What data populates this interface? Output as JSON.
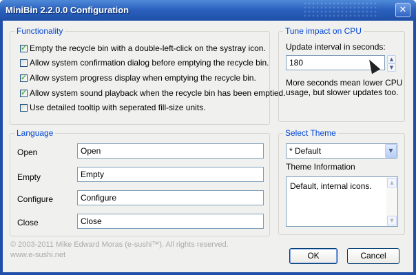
{
  "window": {
    "title": "MiniBin 2.2.0.0 Configuration",
    "close_glyph": "✕"
  },
  "functionality": {
    "label": "Functionality",
    "options": [
      {
        "label": "Empty the recycle bin with a double-left-click on the systray icon.",
        "checked": true
      },
      {
        "label": "Allow system confirmation dialog before emptying the recycle bin.",
        "checked": false
      },
      {
        "label": "Allow system progress display when emptying the recycle bin.",
        "checked": true
      },
      {
        "label": "Allow system sound playback when the recycle bin has been emptied.",
        "checked": true
      },
      {
        "label": "Use detailed tooltip with seperated fill-size units.",
        "checked": false
      }
    ]
  },
  "cpu": {
    "label": "Tune impact on CPU",
    "interval_label": "Update interval in seconds:",
    "interval_value": "180",
    "note_line1": "More seconds mean lower CPU",
    "note_line2": "usage, but slower updates too.",
    "spin_up": "▲",
    "spin_down": "▼"
  },
  "language": {
    "label": "Language",
    "rows": [
      {
        "label": "Open",
        "value": "Open"
      },
      {
        "label": "Empty",
        "value": "Empty"
      },
      {
        "label": "Configure",
        "value": "Configure"
      },
      {
        "label": "Close",
        "value": "Close"
      }
    ]
  },
  "theme": {
    "label": "Select Theme",
    "selected": "* Default",
    "dropdown_glyph": "▼",
    "info_label": "Theme Information",
    "info_text": "Default, internal icons.",
    "scroll_up": "▲",
    "scroll_down": "▼"
  },
  "footer": {
    "copyright": "© 2003-2011 Mike Edward Moras (e-sushi™). All rights reserved.",
    "website": "www.e-sushi.net",
    "ok_label": "OK",
    "cancel_label": "Cancel"
  },
  "colors": {
    "titlebar": "#2c62bf",
    "group_label": "#0046d5",
    "client": "#f0f0ee"
  }
}
